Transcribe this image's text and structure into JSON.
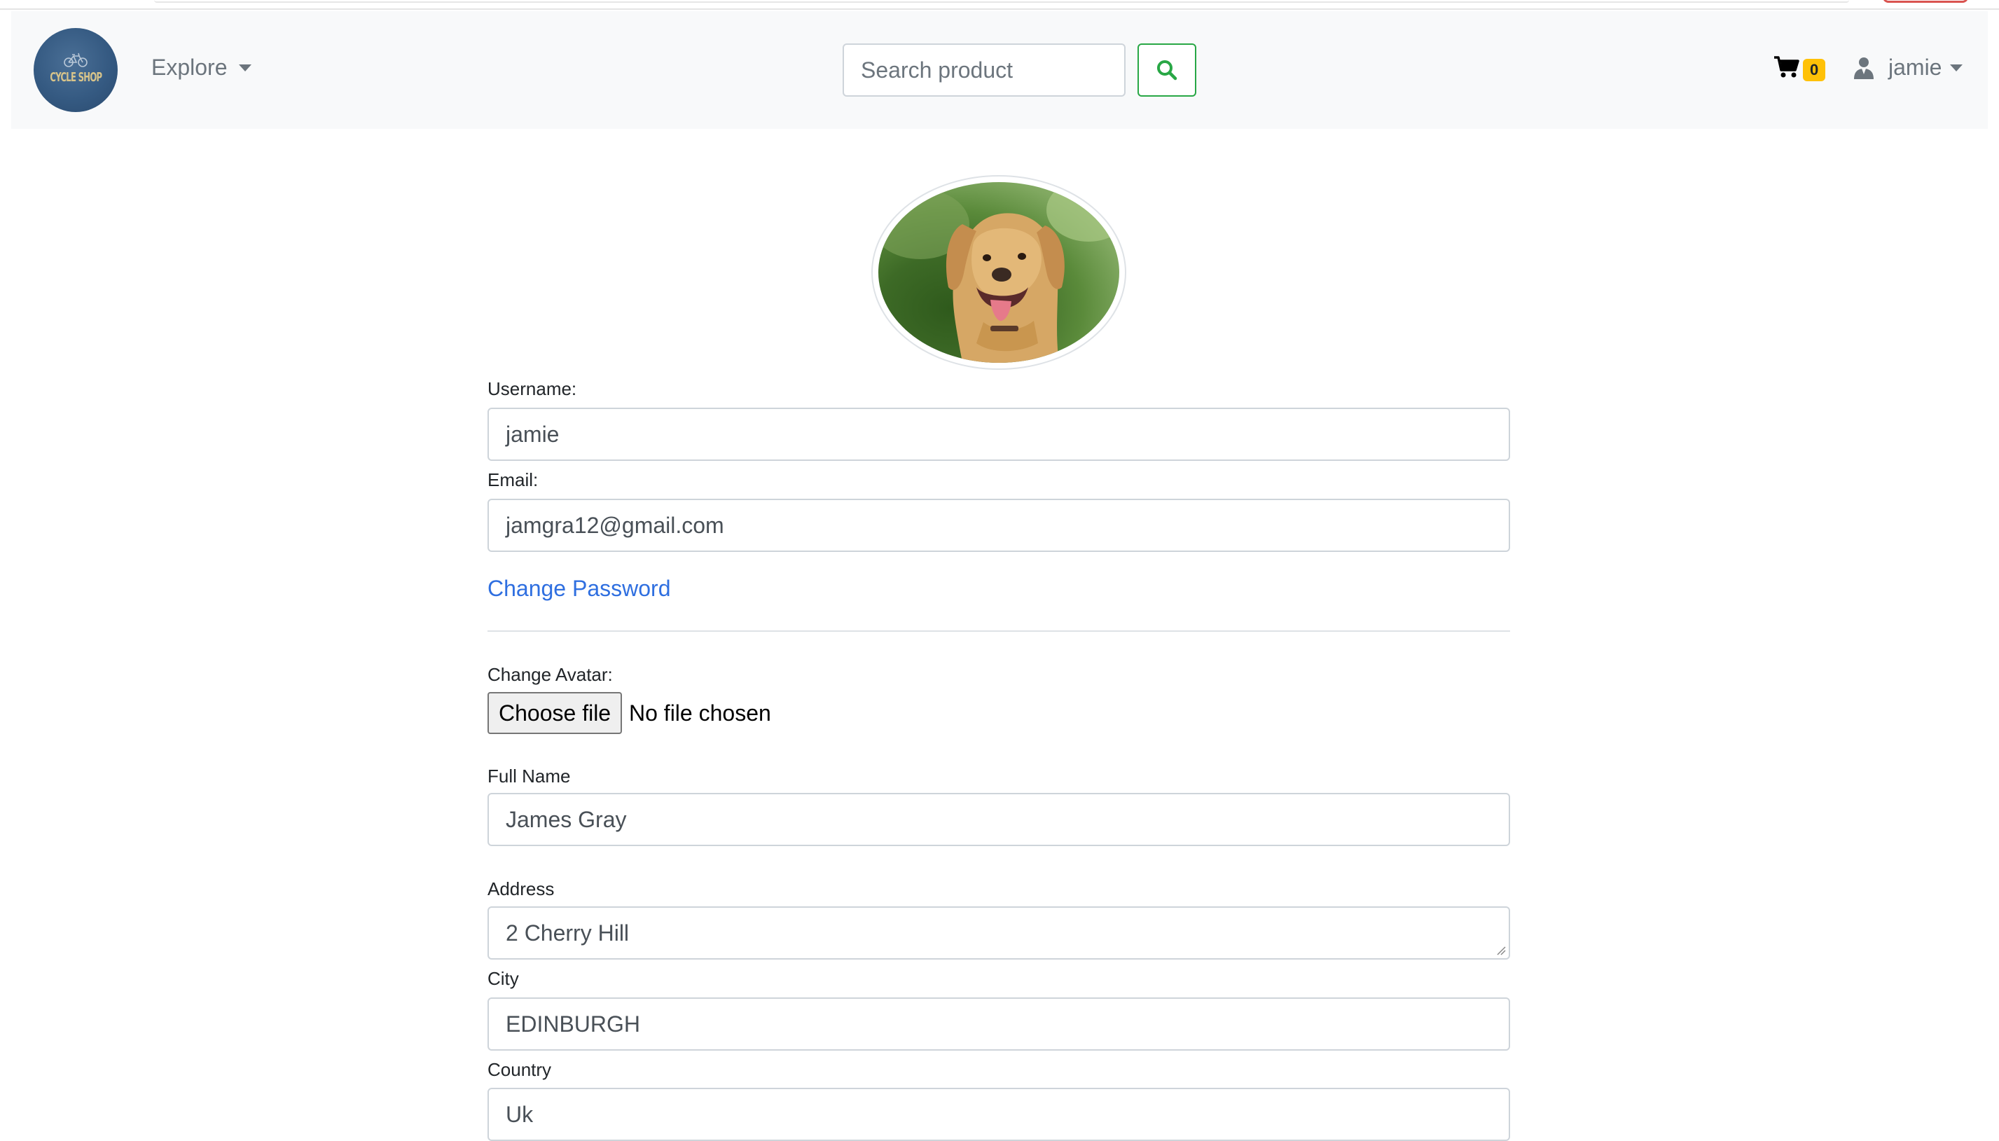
{
  "navbar": {
    "logo_text": "CYCLE SHOP",
    "explore_label": "Explore",
    "search_placeholder": "Search product",
    "cart_count": "0",
    "username": "jamie"
  },
  "profile": {
    "username_label": "Username:",
    "username_value": "jamie",
    "email_label": "Email:",
    "email_value": "jamgra12@gmail.com",
    "change_password_label": "Change Password",
    "avatar_label": "Change Avatar:",
    "choose_file_label": "Choose file",
    "no_file_text": "No file chosen",
    "full_name_label": "Full Name",
    "full_name_value": "James Gray",
    "address_label": "Address",
    "address_value": "2 Cherry Hill",
    "city_label": "City",
    "city_value": "EDINBURGH",
    "country_label": "Country",
    "country_value": "Uk"
  },
  "colors": {
    "navbar_bg": "#f8f9fa",
    "search_button_border": "#28a745",
    "badge_bg": "#ffc107",
    "link": "#2f6fe0"
  },
  "icons": {
    "search": "search-icon",
    "cart": "cart-icon",
    "user": "user-icon",
    "logo": "bicycle-icon"
  }
}
